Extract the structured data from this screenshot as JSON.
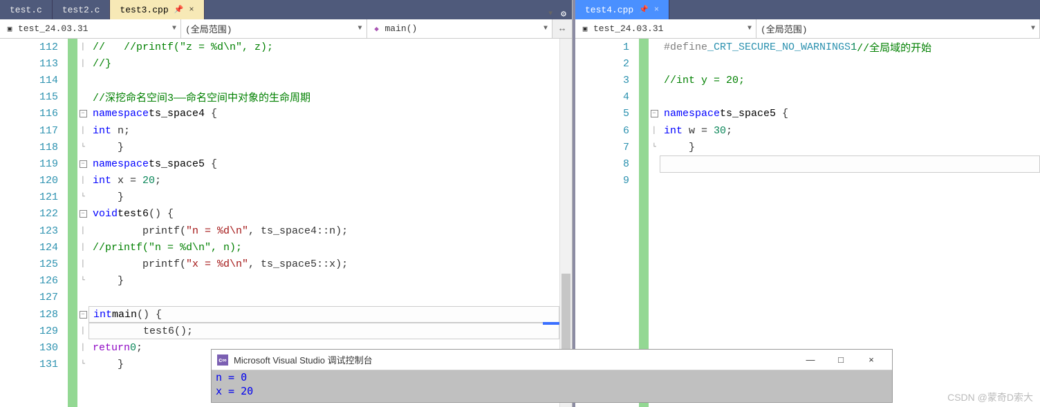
{
  "tabs_left": [
    {
      "label": "test.c",
      "active": false
    },
    {
      "label": "test2.c",
      "active": false
    },
    {
      "label": "test3.cpp",
      "active": true
    }
  ],
  "tabs_right": [
    {
      "label": "test4.cpp",
      "active": true
    }
  ],
  "nav_left": {
    "project": "test_24.03.31",
    "scope": "(全局范围)",
    "func": "main()"
  },
  "nav_right": {
    "project": "test_24.03.31",
    "scope": "(全局范围)"
  },
  "lines_left": [
    "112",
    "113",
    "114",
    "115",
    "116",
    "117",
    "118",
    "119",
    "120",
    "121",
    "122",
    "123",
    "124",
    "125",
    "126",
    "127",
    "128",
    "129",
    "130",
    "131"
  ],
  "code_left": [
    {
      "fold": "|",
      "html": "    <span class='cm'>//   //printf(\"z = %d\\n\", z);</span>"
    },
    {
      "fold": "|",
      "html": "    <span class='cm'>//}</span>"
    },
    {
      "fold": "",
      "html": ""
    },
    {
      "fold": "",
      "html": "    <span class='cm'>//深挖命名空间3——命名空间中对象的生命周期</span>"
    },
    {
      "fold": "-",
      "html": "<span class='kw'>namespace</span> <span class='id'>ts_space4</span> {"
    },
    {
      "fold": "|",
      "html": "        <span class='kw'>int</span> n;"
    },
    {
      "fold": "L",
      "html": "    }"
    },
    {
      "fold": "-",
      "html": "<span class='kw'>namespace</span> <span class='id'>ts_space5</span> {"
    },
    {
      "fold": "|",
      "html": "        <span class='kw'>int</span> x = <span class='num'>20</span>;"
    },
    {
      "fold": "L",
      "html": "    }"
    },
    {
      "fold": "-",
      "html": "<span class='kw'>void</span> <span class='id'>test6</span>() {"
    },
    {
      "fold": "|",
      "html": "        printf(<span class='str'>\"n = %d\\n\"</span>, ts_space4::n);"
    },
    {
      "fold": "|",
      "html": "        <span class='cm'>//printf(\"n = %d\\n\", n);</span>"
    },
    {
      "fold": "|",
      "html": "        printf(<span class='str'>\"x = %d\\n\"</span>, ts_space5::x);"
    },
    {
      "fold": "L",
      "html": "    }"
    },
    {
      "fold": "",
      "html": ""
    },
    {
      "fold": "-",
      "html": "<span class='kw'>int</span> <span class='id'>main</span>() {"
    },
    {
      "fold": "|",
      "html": "        test6();"
    },
    {
      "fold": "|",
      "html": "        <span class='purple'>return</span> <span class='num'>0</span>;"
    },
    {
      "fold": "L",
      "html": "    }"
    }
  ],
  "lines_right": [
    "1",
    "2",
    "3",
    "4",
    "5",
    "6",
    "7",
    "8",
    "9"
  ],
  "code_right": [
    {
      "fold": "",
      "html": "    <span class='mac'>#define</span> <span class='typ'>_CRT_SECURE_NO_WARNINGS</span> <span class='num'>1</span><span class='cm'>//全局域的开始</span>"
    },
    {
      "fold": "",
      "html": ""
    },
    {
      "fold": "",
      "html": "    <span class='cm'>//int y = 20;</span>"
    },
    {
      "fold": "",
      "html": ""
    },
    {
      "fold": "-",
      "html": "<span class='kw'>namespace</span> <span class='id'>ts_space5</span> {"
    },
    {
      "fold": "|",
      "html": "        <span class='kw'>int</span> w = <span class='num'>30</span>;"
    },
    {
      "fold": "L",
      "html": "    }"
    },
    {
      "fold": "",
      "html": ""
    },
    {
      "fold": "",
      "html": ""
    }
  ],
  "console": {
    "title": "Microsoft Visual Studio 调试控制台",
    "lines": [
      "n = 0",
      "x = 20"
    ]
  },
  "watermark": "CSDN @蒙奇D索大",
  "glyphs": {
    "down": "▼",
    "gear": "⚙",
    "pin": "📌",
    "close": "×",
    "split": "↔",
    "min": "—",
    "max": "□"
  }
}
